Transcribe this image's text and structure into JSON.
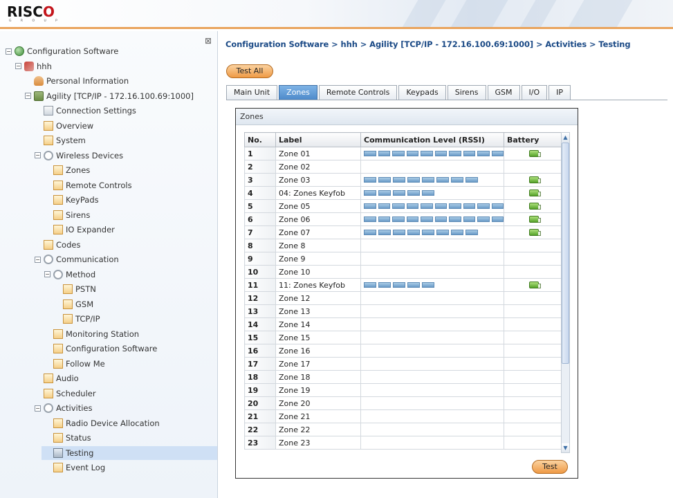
{
  "header": {
    "logo_text_main": "RISC",
    "logo_text_o": "O",
    "logo_sub": "G R O U P",
    "close_icon": "⊠"
  },
  "tree": [
    {
      "label": "Configuration Software",
      "icon": "globe",
      "exp": "−"
    },
    {
      "label": "hhh",
      "icon": "net",
      "exp": "−"
    },
    {
      "label": "Personal Information",
      "icon": "user"
    },
    {
      "label": "Agility [TCP/IP - 172.16.100.69:1000]",
      "icon": "dev",
      "exp": "−"
    },
    {
      "label": "Connection Settings",
      "icon": "conn"
    },
    {
      "label": "Overview",
      "icon": "page"
    },
    {
      "label": "System",
      "icon": "page"
    },
    {
      "label": "Wireless Devices",
      "icon": "gear",
      "exp": "−"
    },
    {
      "label": "Zones",
      "icon": "page"
    },
    {
      "label": "Remote Controls",
      "icon": "page"
    },
    {
      "label": "KeyPads",
      "icon": "page"
    },
    {
      "label": "Sirens",
      "icon": "page"
    },
    {
      "label": "IO Expander",
      "icon": "page"
    },
    {
      "label": "Codes",
      "icon": "page"
    },
    {
      "label": "Communication",
      "icon": "gear",
      "exp": "−"
    },
    {
      "label": "Method",
      "icon": "gear",
      "exp": "−"
    },
    {
      "label": "PSTN",
      "icon": "page"
    },
    {
      "label": "GSM",
      "icon": "page"
    },
    {
      "label": "TCP/IP",
      "icon": "page"
    },
    {
      "label": "Monitoring Station",
      "icon": "page"
    },
    {
      "label": "Configuration Software",
      "icon": "page"
    },
    {
      "label": "Follow Me",
      "icon": "page"
    },
    {
      "label": "Audio",
      "icon": "page"
    },
    {
      "label": "Scheduler",
      "icon": "page"
    },
    {
      "label": "Activities",
      "icon": "gear",
      "exp": "−"
    },
    {
      "label": "Radio Device Allocation",
      "icon": "page"
    },
    {
      "label": "Status",
      "icon": "page"
    },
    {
      "label": "Testing",
      "icon": "test",
      "selected": true
    },
    {
      "label": "Event Log",
      "icon": "page"
    }
  ],
  "breadcrumb": "Configuration Software > hhh > Agility [TCP/IP - 172.16.100.69:1000] > Activities > Testing",
  "test_all_label": "Test All",
  "tabs": [
    {
      "label": "Main Unit"
    },
    {
      "label": "Zones",
      "active": true
    },
    {
      "label": "Remote Controls"
    },
    {
      "label": "Keypads"
    },
    {
      "label": "Sirens"
    },
    {
      "label": "GSM"
    },
    {
      "label": "I/O"
    },
    {
      "label": "IP"
    }
  ],
  "panel": {
    "title": "Zones",
    "test_label": "Test"
  },
  "table": {
    "columns": [
      "No.",
      "Label",
      "Communication Level (RSSI)",
      "Battery"
    ],
    "rssi_max": 10,
    "rows": [
      {
        "no": "1",
        "label": "Zone 01",
        "rssi": 10,
        "battery": true
      },
      {
        "no": "2",
        "label": "Zone 02",
        "rssi": 0,
        "battery": false
      },
      {
        "no": "3",
        "label": "Zone 03",
        "rssi": 8,
        "battery": true
      },
      {
        "no": "4",
        "label": "04: Zones Keyfob",
        "rssi": 5,
        "battery": true
      },
      {
        "no": "5",
        "label": "Zone 05",
        "rssi": 10,
        "battery": true
      },
      {
        "no": "6",
        "label": "Zone 06",
        "rssi": 10,
        "battery": true
      },
      {
        "no": "7",
        "label": "Zone 07",
        "rssi": 8,
        "battery": true
      },
      {
        "no": "8",
        "label": "Zone 8",
        "rssi": 0,
        "battery": false
      },
      {
        "no": "9",
        "label": "Zone 9",
        "rssi": 0,
        "battery": false
      },
      {
        "no": "10",
        "label": "Zone 10",
        "rssi": 0,
        "battery": false
      },
      {
        "no": "11",
        "label": "11: Zones Keyfob",
        "rssi": 5,
        "battery": true
      },
      {
        "no": "12",
        "label": "Zone 12",
        "rssi": 0,
        "battery": false
      },
      {
        "no": "13",
        "label": "Zone 13",
        "rssi": 0,
        "battery": false
      },
      {
        "no": "14",
        "label": "Zone 14",
        "rssi": 0,
        "battery": false
      },
      {
        "no": "15",
        "label": "Zone 15",
        "rssi": 0,
        "battery": false
      },
      {
        "no": "16",
        "label": "Zone 16",
        "rssi": 0,
        "battery": false
      },
      {
        "no": "17",
        "label": "Zone 17",
        "rssi": 0,
        "battery": false
      },
      {
        "no": "18",
        "label": "Zone 18",
        "rssi": 0,
        "battery": false
      },
      {
        "no": "19",
        "label": "Zone 19",
        "rssi": 0,
        "battery": false
      },
      {
        "no": "20",
        "label": "Zone 20",
        "rssi": 0,
        "battery": false
      },
      {
        "no": "21",
        "label": "Zone 21",
        "rssi": 0,
        "battery": false
      },
      {
        "no": "22",
        "label": "Zone 22",
        "rssi": 0,
        "battery": false
      },
      {
        "no": "23",
        "label": "Zone 23",
        "rssi": 0,
        "battery": false
      }
    ]
  },
  "scroll_icons": {
    "up": "▲",
    "down": "▼"
  }
}
